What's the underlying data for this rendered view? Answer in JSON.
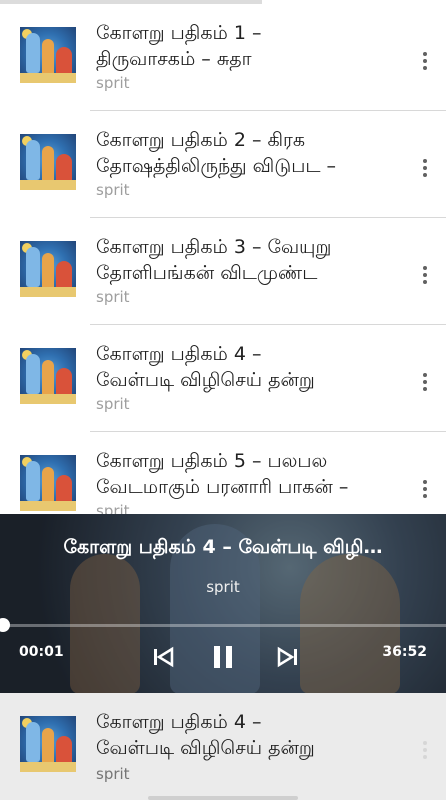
{
  "tracks": [
    {
      "title_line1": "கோளறு பதிகம் 1 –",
      "title_line2": "திருவாசகம் – சுதா",
      "artist": "sprit"
    },
    {
      "title_line1": "கோளறு பதிகம் 2 – கிரக",
      "title_line2": "தோஷத்திலிருந்து விடுபட –",
      "artist": "sprit"
    },
    {
      "title_line1": "கோளறு பதிகம் 3 – வேயுறு",
      "title_line2": "தோளிபங்கன் விடமுண்ட",
      "artist": "sprit"
    },
    {
      "title_line1": "கோளறு பதிகம் 4 –",
      "title_line2": "வேள்படி விழிசெய் தன்று",
      "artist": "sprit"
    },
    {
      "title_line1": "கோளறு பதிகம் 5 – பலபல",
      "title_line2": "வேடமாகும் பரனாரி பாகன் –",
      "artist": "sprit"
    }
  ],
  "player": {
    "title": "கோளறு பதிகம் 4 – வேள்படி விழி…",
    "artist": "sprit",
    "elapsed": "00:01",
    "duration": "36:52",
    "progress_fraction": 0.0005,
    "prev_icon": "skip-previous-icon",
    "pause_icon": "pause-icon",
    "next_icon": "skip-next-icon"
  },
  "mini_player": {
    "title_line1": "கோளறு பதிகம் 4 –",
    "title_line2": "வேள்படி விழிசெய் தன்று",
    "artist": "sprit"
  },
  "colors": {
    "text_primary": "#212121",
    "text_secondary": "#9e9e9e",
    "mini_bg": "#ebebeb"
  }
}
